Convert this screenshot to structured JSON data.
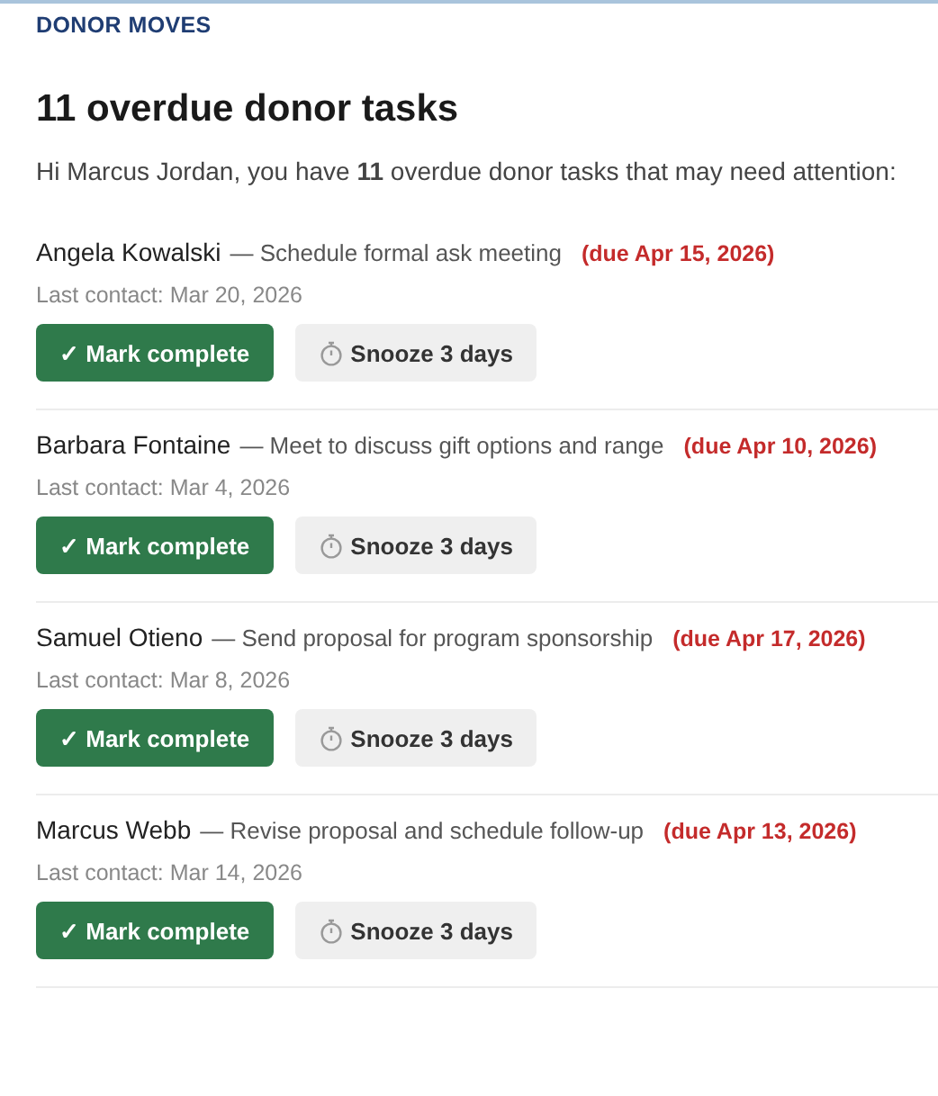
{
  "header": {
    "label": "DONOR MOVES"
  },
  "title": "11 overdue donor tasks",
  "intro": "Hi Marcus Jordan, you have **11** overdue donor tasks that may need attention:",
  "tasks": [
    {
      "donor": "Angela Kowalski",
      "task": "— Schedule formal ask meeting",
      "due": "(due Apr 15, 2026)",
      "last_contact": "Last contact: Mar 20, 2026",
      "complete_label": "✓ Mark complete",
      "snooze_label": "Snooze 3 days"
    },
    {
      "donor": "Barbara Fontaine",
      "task": "— Meet to discuss gift options and range",
      "due": "(due Apr 10, 2026)",
      "last_contact": "Last contact: Mar 4, 2026",
      "complete_label": "✓ Mark complete",
      "snooze_label": "Snooze 3 days"
    },
    {
      "donor": "Samuel Otieno",
      "task": "— Send proposal for program sponsorship",
      "due": "(due Apr 17, 2026)",
      "last_contact": "Last contact: Mar 8, 2026",
      "complete_label": "✓ Mark complete",
      "snooze_label": "Snooze 3 days"
    },
    {
      "donor": "Marcus Webb",
      "task": "— Revise proposal and schedule follow-up",
      "due": "(due Apr 13, 2026)",
      "last_contact": "Last contact: Mar 14, 2026",
      "complete_label": "✓ Mark complete",
      "snooze_label": "Snooze 3 days"
    }
  ]
}
